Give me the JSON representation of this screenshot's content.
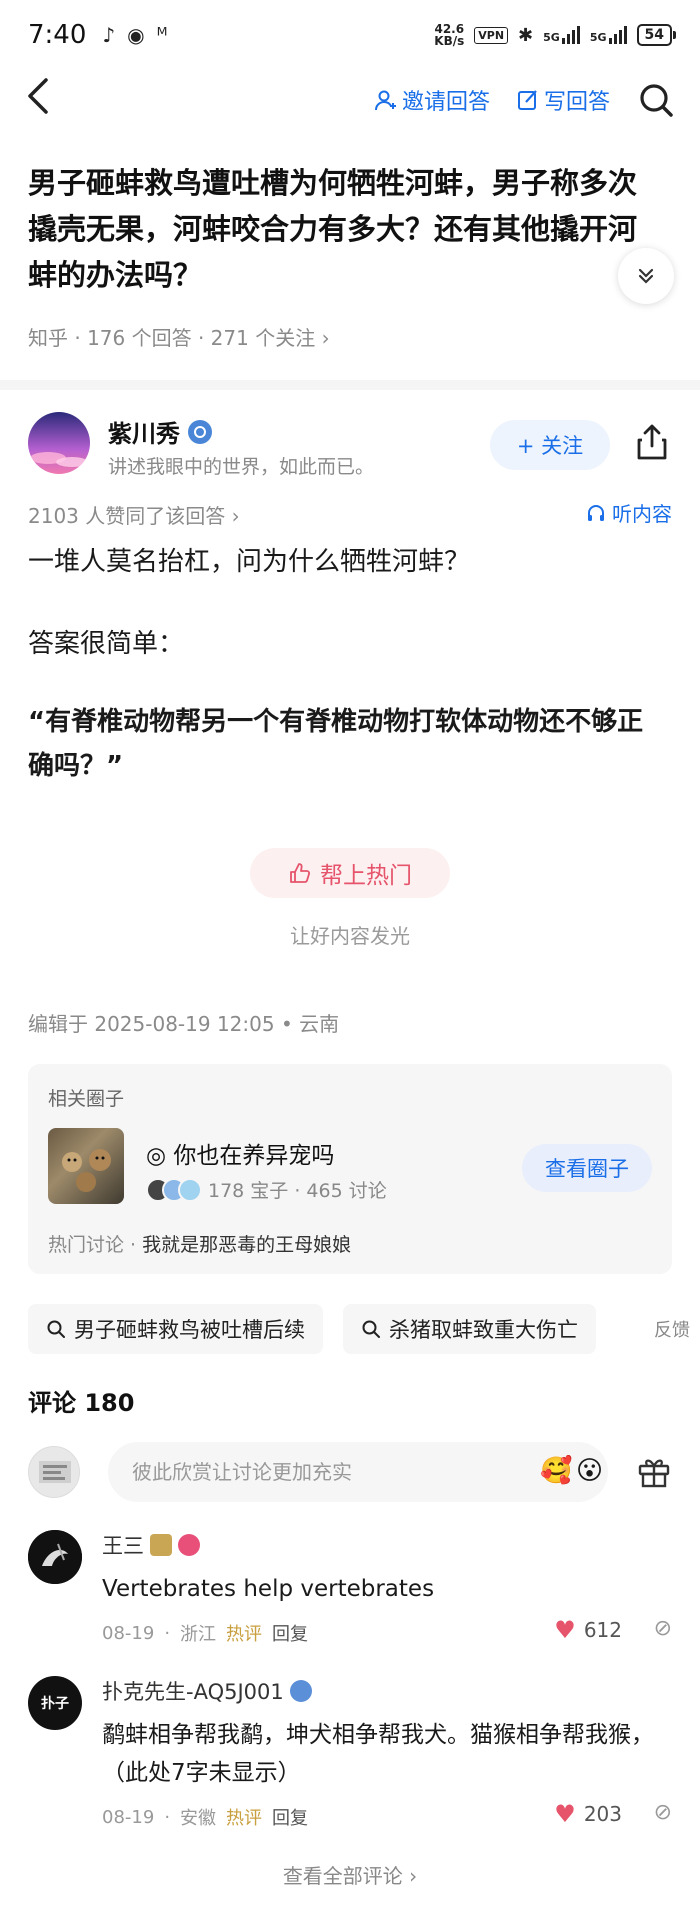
{
  "status_bar": {
    "time": "7:40",
    "net_speed": "42.6",
    "net_unit": "KB/s",
    "vpn": "VPN",
    "signal_1": "5G",
    "signal_2": "5G",
    "battery": "54",
    "left_icons": [
      "tiktok-icon",
      "qq-icon",
      "mail-icon"
    ]
  },
  "nav": {
    "invite_label": "邀请回答",
    "write_label": "写回答"
  },
  "question": {
    "title": "男子砸蚌救鸟遭吐槽为何牺牲河蚌，男子称多次撬壳无果，河蚌咬合力有多大？还有其他撬开河蚌的办法吗？",
    "meta": "知乎 · 176 个回答 · 271 个关注 ›",
    "collapse_icon": "chevron-double-down-icon"
  },
  "author": {
    "name": "紫川秀",
    "bio": "讲述我眼中的世界，如此而已。",
    "follow_label": "+ 关注"
  },
  "answer": {
    "upvotes": "2103 人赞同了该回答 ›",
    "listen_label": "听内容",
    "p1": "一堆人莫名抬杠，问为什么牺牲河蚌？",
    "p2": "答案很简单：",
    "p3": "“有脊椎动物帮另一个有脊椎动物打软体动物还不够正确吗？”",
    "hot_label": "帮上热门",
    "hot_sub": "让好内容发光",
    "edit_meta": "编辑于 2025-08-19 12:05 • 云南"
  },
  "circle": {
    "section_title": "相关圈子",
    "name": "◎ 你也在养异宠吗",
    "stats": "178 宝子 · 465 讨论",
    "button_label": "查看圈子",
    "hot_prefix": "热门讨论 ·",
    "hot_topic": "我就是那恶毒的王母娘娘"
  },
  "related": {
    "items": [
      "男子砸蚌救鸟被吐槽后续",
      "杀猪取蚌致重大伤亡"
    ],
    "feedback": "反馈"
  },
  "comments": {
    "title": "评论 180",
    "input_placeholder": "彼此欣赏让讨论更加充实",
    "list": [
      {
        "name": "王三",
        "text": "Vertebrates help vertebrates",
        "date": "08-19",
        "location": "浙江",
        "hot": "热评",
        "reply": "回复",
        "likes": "612"
      },
      {
        "name": "扑克先生-AQ5J001",
        "avatar_text": "扑子",
        "text": "鹬蚌相争帮我鹬，坤犬相争帮我犬。猫猴相争帮我猴，（此处7字未显示）",
        "date": "08-19",
        "location": "安徽",
        "hot": "热评",
        "reply": "回复",
        "likes": "203"
      }
    ],
    "see_all": "查看全部评论 ›"
  },
  "colors": {
    "accent_blue": "#1a6fe8",
    "hot_pink": "#e5546b",
    "heart_red": "#e5546b"
  }
}
